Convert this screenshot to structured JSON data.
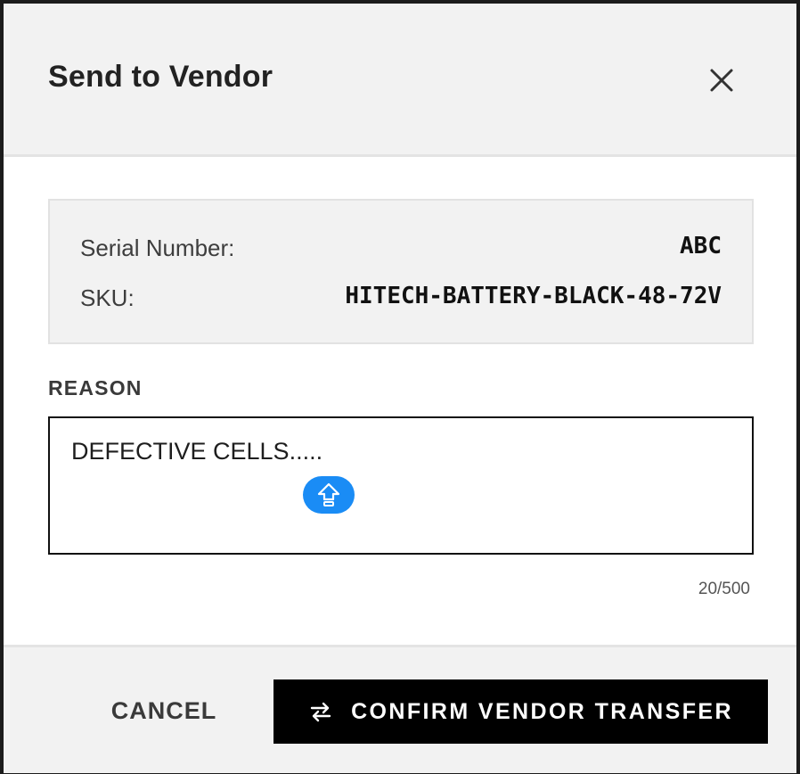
{
  "dialog": {
    "title": "Send to Vendor"
  },
  "info": {
    "serial_label": "Serial Number:",
    "serial_value": "ABC",
    "sku_label": "SKU:",
    "sku_value": "HITECH-BATTERY-BLACK-48-72V"
  },
  "reason": {
    "label": "REASON",
    "value": "DEFECTIVE CELLS.....",
    "char_count": "20/500"
  },
  "footer": {
    "cancel_label": "CANCEL",
    "confirm_label": "CONFIRM VENDOR TRANSFER"
  },
  "icons": {
    "close": "close-icon",
    "floating_action": "arrow-up-icon",
    "confirm": "swap-arrows-icon"
  },
  "colors": {
    "accent": "#1a8cf5",
    "primary_button": "#000000",
    "header_bg": "#f2f2f2"
  }
}
